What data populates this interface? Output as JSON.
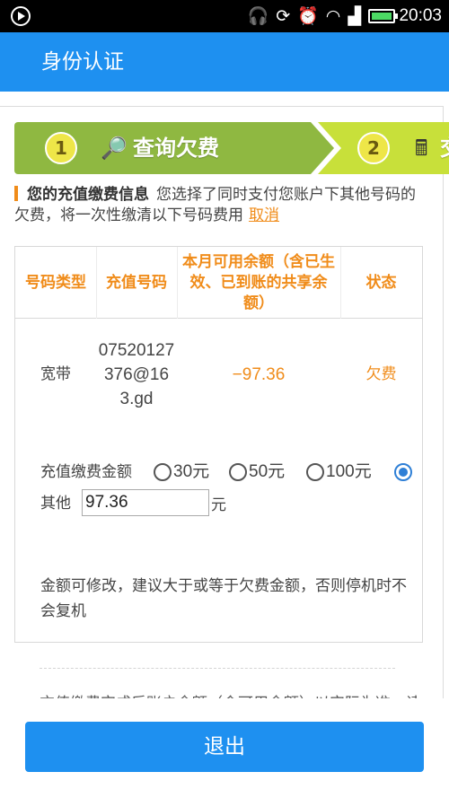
{
  "status_bar": {
    "time": "20:03",
    "icons": [
      "play-circle-icon",
      "headphones-icon",
      "sync-icon",
      "alarm-icon",
      "wifi-icon",
      "signal-icon",
      "battery-icon"
    ]
  },
  "header": {
    "title": "身份认证"
  },
  "steps": [
    {
      "number": "1",
      "label": "查询欠费",
      "icon": "magnifier-icon",
      "icon_glyph": "🔎"
    },
    {
      "number": "2",
      "label": "交",
      "icon": "calculator-icon",
      "icon_glyph": "🖩"
    }
  ],
  "info": {
    "title": "您的充值缴费信息",
    "text": "您选择了同时支付您账户下其他号码的欠费，将一次性缴清以下号码费用",
    "cancel_link": "取消"
  },
  "table": {
    "headers": [
      "号码类型",
      "充值号码",
      "本月可用余额（含已生效、已到账的共享余额）",
      "状态"
    ],
    "rows": [
      {
        "type": "宽带",
        "number": "07520127376@163.gd",
        "balance": "−97.36",
        "status": "欠费"
      }
    ]
  },
  "payment": {
    "label": "充值缴费金额",
    "options": [
      {
        "label": "30元",
        "checked": false
      },
      {
        "label": "50元",
        "checked": false
      },
      {
        "label": "100元",
        "checked": false
      },
      {
        "label": "",
        "checked": true
      }
    ],
    "other_label": "其他",
    "other_value": "97.36",
    "other_unit": "元"
  },
  "hint": "金额可修改，建议大于或等于欠费金额，否则停机时不会复机",
  "footer_partial_text": "充值缴费完成后账户余额（含可用余额）以实际为准，请以实际到账为准",
  "exit_button": "退出",
  "colors": {
    "primary_blue": "#1e90f0",
    "accent_orange": "#f08c1a",
    "step_green": "#8fb841",
    "step_yellow_green": "#c8e03a"
  }
}
